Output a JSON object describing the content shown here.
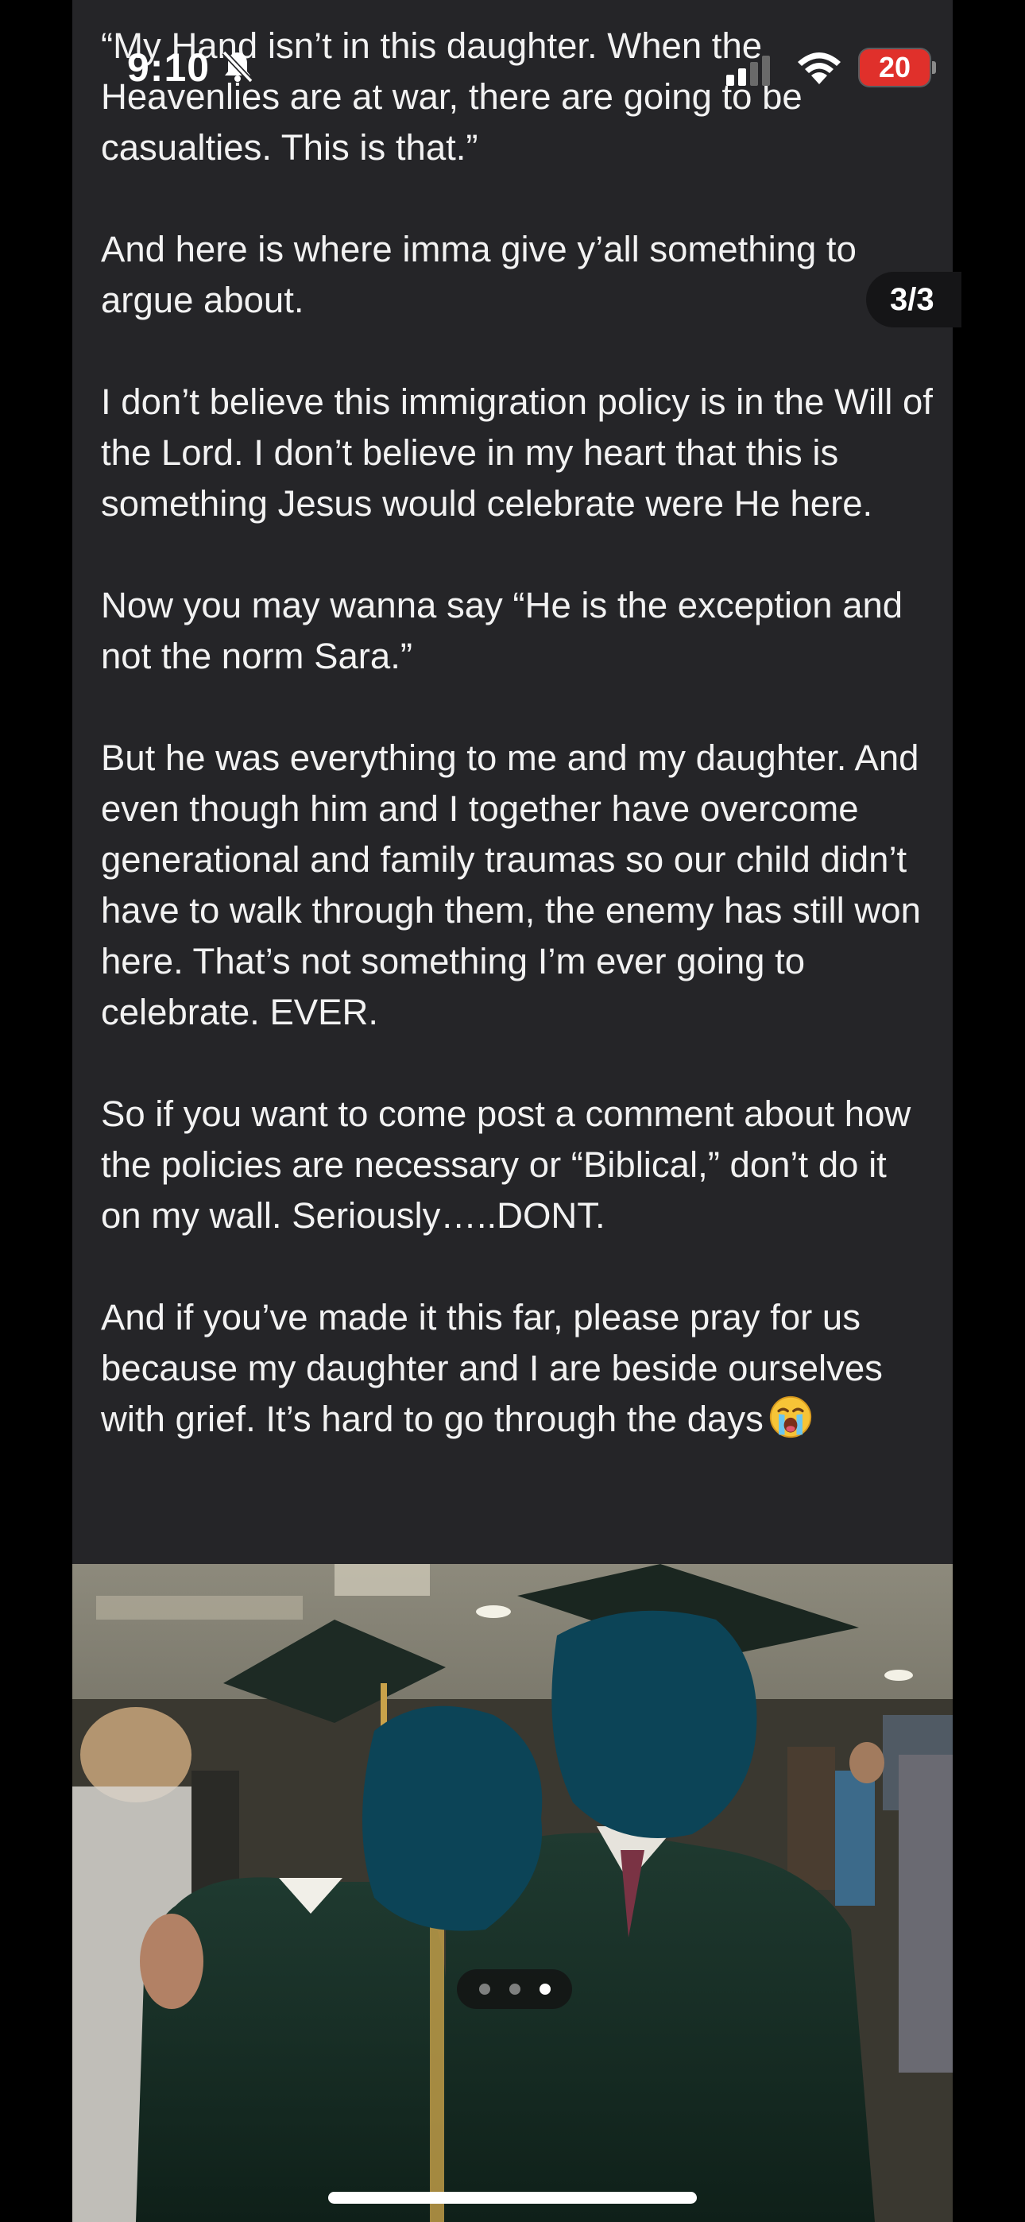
{
  "status_bar": {
    "time": "9:10",
    "battery_level": "20",
    "battery_color": "#e0302b"
  },
  "post": {
    "paragraphs": [
      "“My Hand isn’t in this daughter. When the Heavenlies are at war, there are going to be casualties. This is that.”",
      "And here is where imma give y’all something to argue about.",
      "I don’t believe this immigration policy is in the Will of the Lord. I don’t believe in my heart that this is something Jesus would celebrate were He here.",
      "Now you may wanna say “He is the exception and not the norm Sara.”",
      "But he was everything to me and my daughter. And even though him and I together have overcome generational and family traumas so our child didn’t have to walk through them, the enemy has still won here. That’s not something I’m ever going to celebrate. EVER.",
      "So if you want to come post a comment about how the policies are necessary or “Biblical,” don’t do it on my wall. Seriously…..DONT.",
      "And if you’ve made it this far, please pray for us because my daughter and I are beside ourselves with grief. It’s hard to go through the days"
    ],
    "last_emoji": "loudly-crying-face-icon"
  },
  "page_counter": "3/3",
  "carousel": {
    "total": 3,
    "active_index": 3
  },
  "photo": {
    "description_icon": "graduation-photo"
  }
}
